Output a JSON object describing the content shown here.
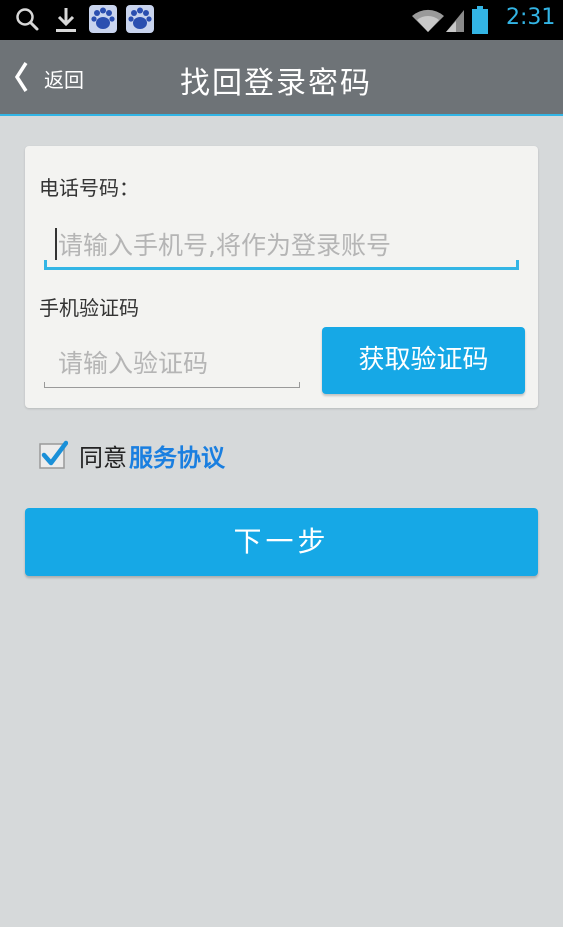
{
  "status_bar": {
    "time": "2:31",
    "icons": [
      "search-icon",
      "download-icon",
      "baidu-paw-icon",
      "baidu-paw-icon",
      "wifi-icon",
      "signal-icon",
      "battery-icon"
    ]
  },
  "header": {
    "back_label": "返回",
    "title": "找回登录密码"
  },
  "form": {
    "phone_label": "电话号码：",
    "phone_placeholder": "请输入手机号,将作为登录账号",
    "phone_value": "",
    "code_label": "手机验证码",
    "code_placeholder": "请输入验证码",
    "code_value": "",
    "get_code_button": "获取验证码"
  },
  "agreement": {
    "checked": true,
    "text": "同意",
    "link": "服务协议"
  },
  "next_button": "下一步",
  "colors": {
    "accent": "#16a8e6",
    "header_bg": "#6e7377",
    "page_bg": "#d6d9da",
    "link": "#1a7fe0"
  }
}
